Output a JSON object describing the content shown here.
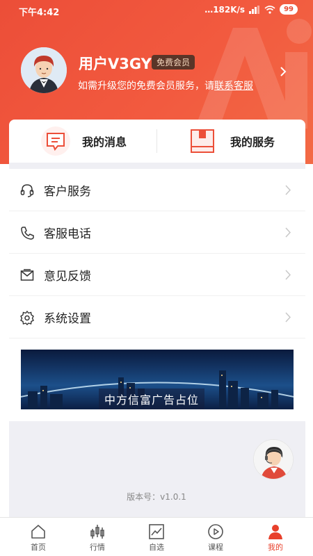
{
  "status_bar": {
    "time": "下午4:42",
    "network_speed": "…182K/s",
    "battery": "99"
  },
  "profile": {
    "username": "用户V3GY",
    "membership": "免费会员",
    "upgrade_prefix": "如需升级您的免费会员服务，请",
    "upgrade_link": "联系客服"
  },
  "quick_actions": [
    {
      "label": "我的消息",
      "icon": "message-icon"
    },
    {
      "label": "我的服务",
      "icon": "service-box-icon"
    }
  ],
  "menu": [
    {
      "label": "客户服务",
      "icon": "headset-icon"
    },
    {
      "label": "客服电话",
      "icon": "phone-icon"
    },
    {
      "label": "意见反馈",
      "icon": "mail-icon"
    },
    {
      "label": "系统设置",
      "icon": "gear-icon"
    }
  ],
  "banner": {
    "caption": "中方信富广告占位"
  },
  "version": "版本号：v1.0.1",
  "tabs": [
    {
      "label": "首页",
      "icon": "home-icon",
      "active": false
    },
    {
      "label": "行情",
      "icon": "candlestick-icon",
      "active": false
    },
    {
      "label": "自选",
      "icon": "chart-icon",
      "active": false
    },
    {
      "label": "课程",
      "icon": "play-icon",
      "active": false
    },
    {
      "label": "我的",
      "icon": "user-icon",
      "active": true
    }
  ],
  "colors": {
    "brand": "#ec4e38",
    "active_tab": "#e8402b",
    "badge_bg": "#5a3528"
  }
}
